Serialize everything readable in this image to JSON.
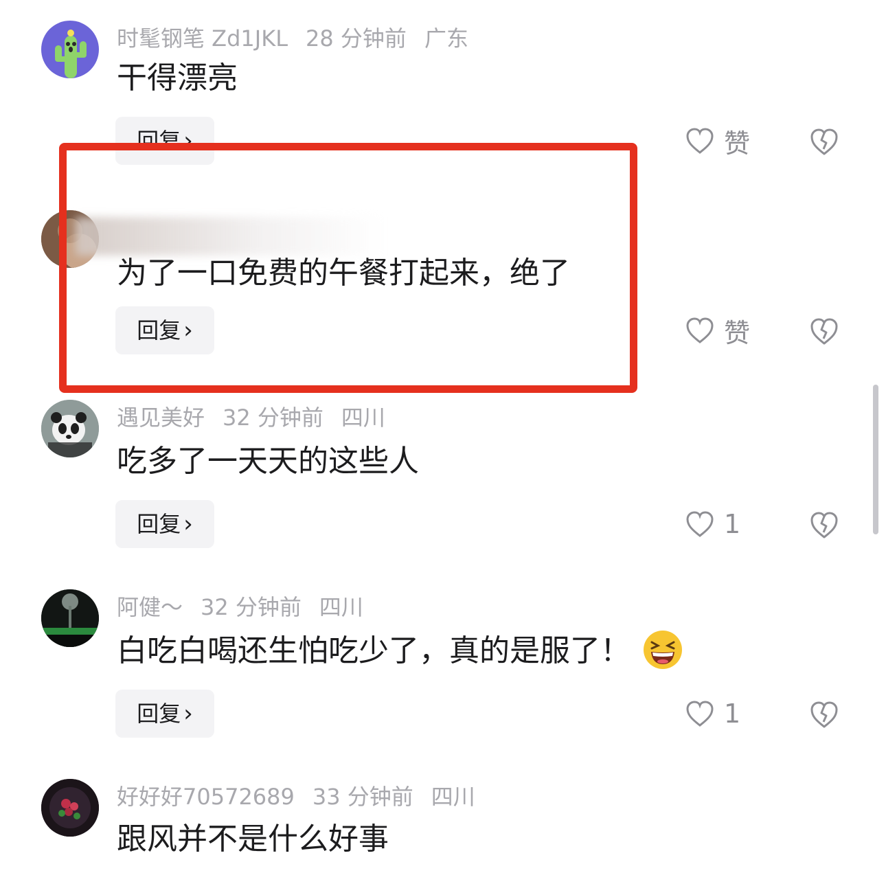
{
  "comments": [
    {
      "username": "时髦钢笔 Zd1JKL",
      "time": "28 分钟前",
      "location": "广东",
      "text": "干得漂亮",
      "reply_label": "回复",
      "likes": "赞",
      "avatar_icon": "cactus-avatar"
    },
    {
      "username": "",
      "time": "",
      "location": "",
      "text": "为了一口免费的午餐打起来，绝了",
      "reply_label": "回复",
      "likes": "赞",
      "avatar_icon": "person-avatar-blurred"
    },
    {
      "username": "遇见美好",
      "time": "32 分钟前",
      "location": "四川",
      "text": "吃多了一天天的这些人",
      "reply_label": "回复",
      "likes": "1",
      "avatar_icon": "panda-avatar"
    },
    {
      "username": "阿健～",
      "time": "32 分钟前",
      "location": "四川",
      "text": "白吃白喝还生怕吃少了，真的是服了！",
      "reply_label": "回复",
      "likes": "1",
      "avatar_icon": "night-scene-avatar",
      "emoji": "grinning-squint-emoji"
    },
    {
      "username": "好好好70572689",
      "time": "33 分钟前",
      "location": "四川",
      "text": "跟风并不是什么好事",
      "avatar_icon": "flower-avatar"
    }
  ],
  "highlight_color": "#e5301e"
}
